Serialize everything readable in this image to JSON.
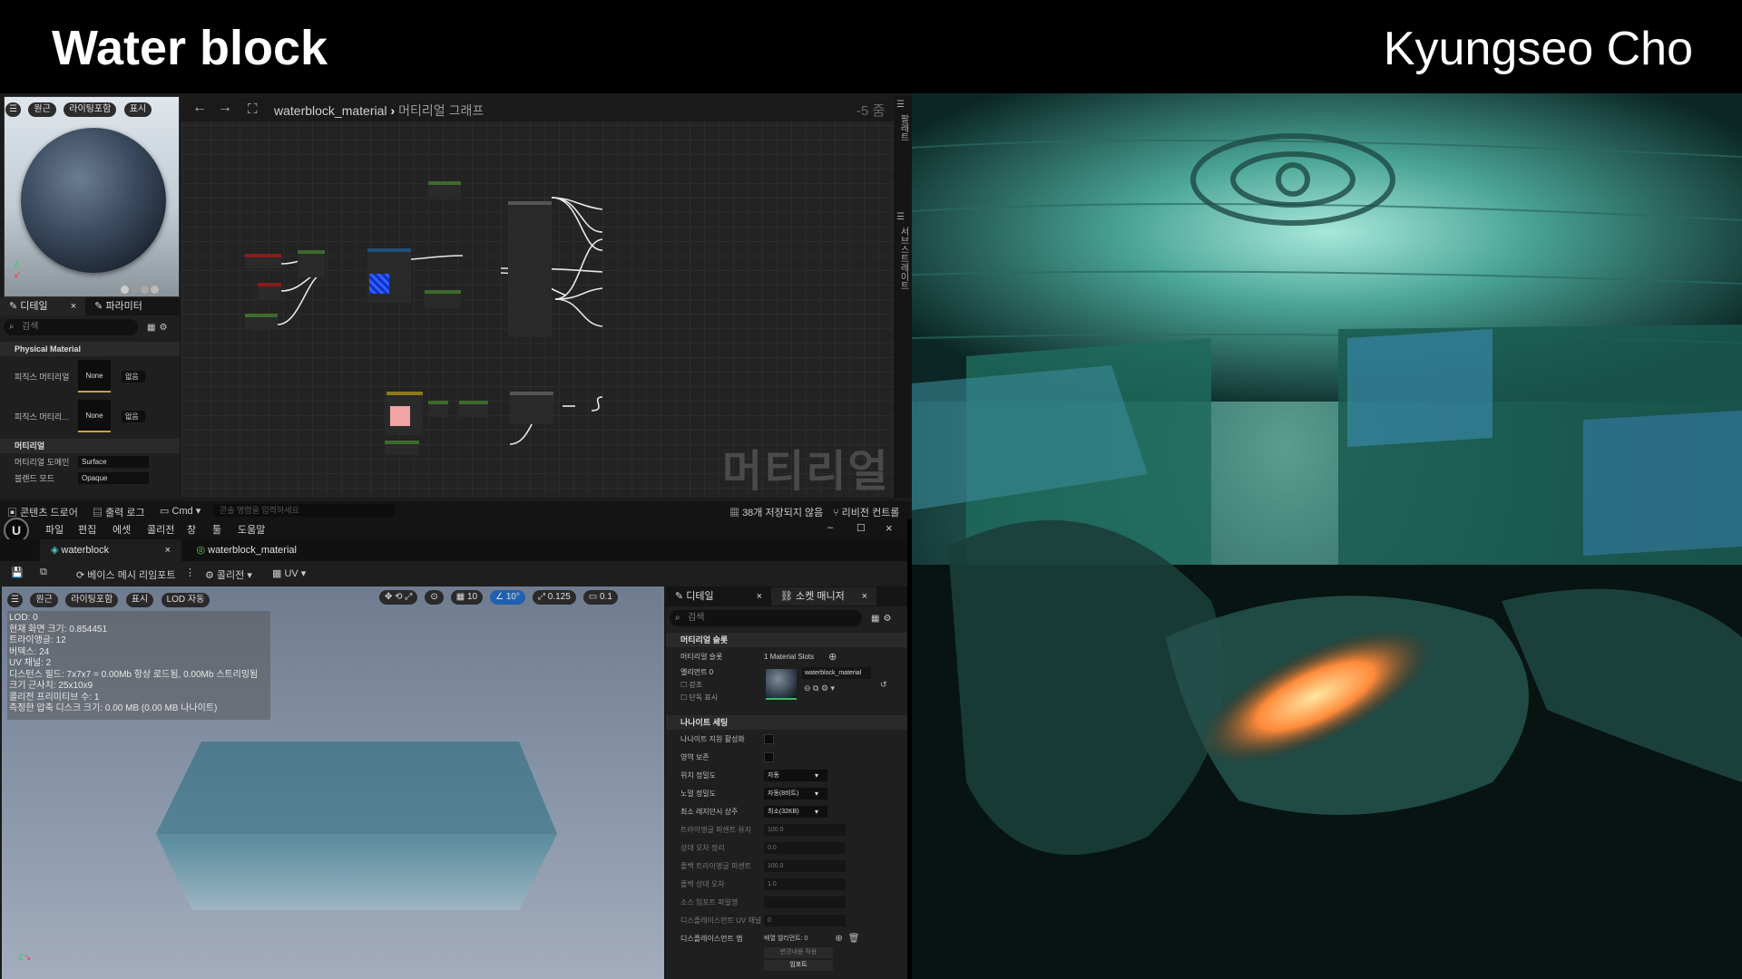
{
  "slide": {
    "title": "Water block",
    "author": "Kyungseo Cho"
  },
  "material_editor": {
    "preview_bar": [
      "원근",
      "라이팅포함",
      "표시"
    ],
    "breadcrumb": {
      "asset": "waterblock_material",
      "graph": "머티리얼 그래프"
    },
    "zoom": "-5 줌",
    "watermark": "머티리얼",
    "side_labels": [
      "팔레트",
      "서브스트레이트"
    ],
    "details": {
      "tabs": [
        "디테일",
        "파라미터"
      ],
      "search_placeholder": "검색",
      "sections": [
        {
          "name": "Physical Material",
          "rows": [
            {
              "label": "피직스 머티리얼",
              "value": "None",
              "dropdown": "없음"
            },
            {
              "label": "피직스 머티리...",
              "value": "None",
              "dropdown": "없음"
            }
          ]
        },
        {
          "name": "머티리얼",
          "rows": [
            {
              "label": "머티리얼 도메인",
              "value": "Surface"
            },
            {
              "label": "블렌드 모드",
              "value": "Opaque"
            }
          ]
        }
      ]
    },
    "status_bar": {
      "content_drawer": "콘텐츠 드로어",
      "output_log": "출력 로그",
      "cmd": "Cmd",
      "console_placeholder": "콘솔 명령을 입력하세요",
      "unsaved": "38개 저장되지 않음",
      "revision": "리비전 컨트롤"
    }
  },
  "mesh_editor": {
    "menu": [
      "파일",
      "편집",
      "에셋",
      "콜리전",
      "창",
      "툴",
      "도움말"
    ],
    "tabs": [
      "waterblock",
      "waterblock_material"
    ],
    "toolbar": [
      "베이스 메시 리임포트",
      "콜리전",
      "UV"
    ],
    "viewport_bar": [
      "원근",
      "라이팅포함",
      "표시",
      "LOD 자동"
    ],
    "viewport_right": [
      "10",
      "10°",
      "0.125",
      "0.1"
    ],
    "stats": [
      "LOD: 0",
      "현재 화면 크기: 0.854451",
      "트라이앵글: 12",
      "버텍스: 24",
      "UV 채널: 2",
      "디스턴스 필드: 7x7x7 = 0.00Mb 항상 로드됨, 0.00Mb 스트리밍됨",
      "크기 근사치: 25x10x9",
      "콜리전 프리미티브 수: 1",
      "측정한 압축 디스크 크기: 0.00 MB (0.00 MB 나나이트)"
    ],
    "details": {
      "tabs": [
        "디테일",
        "소켓 매니저"
      ],
      "search_placeholder": "검색",
      "material_section": "머티리얼 슬롯",
      "material_slots_label": "머티리얼 슬롯",
      "material_slots_value": "1 Material Slots",
      "element_label": "엘리먼트 0",
      "highlight": "강조",
      "isolate": "단독 표시",
      "material_name": "waterblock_material",
      "nanite_section": "나나이트 세팅",
      "rows": [
        {
          "label": "나나이트 지원 활성화",
          "type": "check"
        },
        {
          "label": "영역 보존",
          "type": "check"
        },
        {
          "label": "위치 정밀도",
          "type": "dropdown",
          "value": "자동"
        },
        {
          "label": "노멀 정밀도",
          "type": "dropdown",
          "value": "자동(8비트)"
        },
        {
          "label": "최소 레지던시 상주",
          "type": "dropdown",
          "value": "최소(32KB)"
        },
        {
          "label": "트라이앵글 퍼센트 유지",
          "type": "text",
          "value": "100.0"
        },
        {
          "label": "상대 오차 정리",
          "type": "text",
          "value": "0.0"
        },
        {
          "label": "폴백 트라이앵글 퍼센트",
          "type": "text",
          "value": "100.0"
        },
        {
          "label": "폴백 상대 오차",
          "type": "text",
          "value": "1.0"
        },
        {
          "label": "소스 임포트 파일명",
          "type": "text",
          "value": ""
        },
        {
          "label": "디스플레이스먼트 UV 채널",
          "type": "text",
          "value": "0"
        }
      ],
      "displacement_label": "디스플레이스먼트 맵",
      "displacement_value": "배열 엘리먼트: 0",
      "apply_button": "변경내용 적용",
      "import_button": "임포트"
    }
  }
}
